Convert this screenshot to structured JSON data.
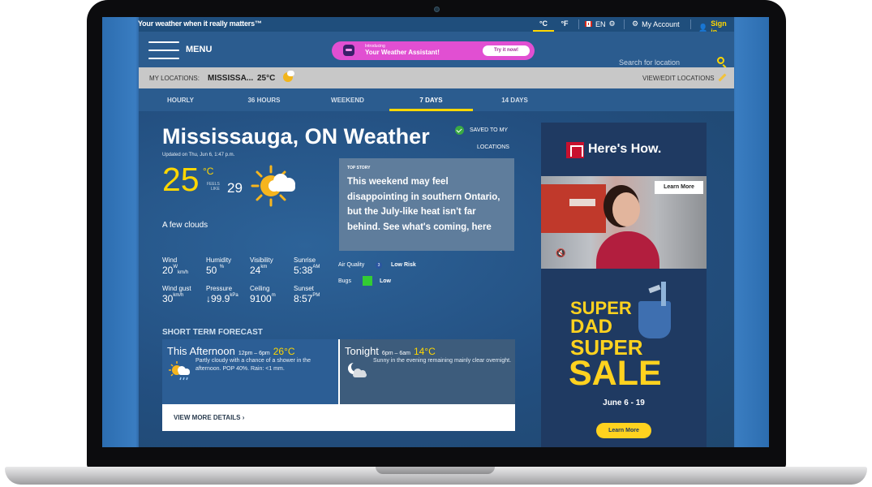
{
  "topbar": {
    "tagline": "Your weather when it really matters™",
    "unit_c": "°C",
    "unit_f": "°F",
    "lang": "EN",
    "my_account": "My Account",
    "sign_in": "Sign in"
  },
  "header": {
    "menu_label": "MENU",
    "assistant_intro": "Introducing",
    "assistant_title": "Your Weather Assistant!",
    "assistant_button": "Try it now!",
    "search_placeholder": "Search for location"
  },
  "locations_bar": {
    "label": "MY LOCATIONS:",
    "city": "MISSISSA...",
    "temp": "25°C",
    "edit_label": "VIEW/EDIT LOCATIONS"
  },
  "tabs": [
    {
      "label": "HOURLY",
      "active": false
    },
    {
      "label": "36 HOURS",
      "active": false
    },
    {
      "label": "WEEKEND",
      "active": false
    },
    {
      "label": "7 DAYS",
      "active": true
    },
    {
      "label": "14 DAYS",
      "active": false
    }
  ],
  "current": {
    "title": "Mississauga, ON Weather",
    "updated": "Updated on Thu, Jun 6, 1:47 p.m.",
    "saved_line1": "SAVED TO MY",
    "saved_line2": "LOCATIONS",
    "temp": "25",
    "temp_unit": "°C",
    "feels_like_label_1": "FEELS",
    "feels_like_label_2": "LIKE",
    "feels_like": "29",
    "condition": "A few clouds",
    "icon": "sun-cloud-icon"
  },
  "top_story": {
    "tag": "TOP STORY",
    "text": "This weekend may feel disappointing in southern Ontario, but the July-like heat isn't far behind. See what's coming, here"
  },
  "stats": {
    "wind": {
      "label": "Wind",
      "value": "20",
      "dir": "W",
      "unit": "km/h"
    },
    "humidity": {
      "label": "Humidity",
      "value": "50",
      "unit": "%"
    },
    "visibility": {
      "label": "Visibility",
      "value": "24",
      "unit": "km"
    },
    "sunrise": {
      "label": "Sunrise",
      "value": "5:38",
      "unit": "AM"
    },
    "wind_gust": {
      "label": "Wind gust",
      "value": "30",
      "unit": "km/h"
    },
    "pressure": {
      "label": "Pressure",
      "value": "↓99.9",
      "unit": "kPa"
    },
    "ceiling": {
      "label": "Ceiling",
      "value": "9100",
      "unit": "m"
    },
    "sunset": {
      "label": "Sunset",
      "value": "8:57",
      "unit": "PM"
    },
    "air_quality_label": "Air Quality",
    "air_quality_index": "3",
    "air_quality_value": "Low Risk",
    "bugs_label": "Bugs",
    "bugs_value": "Low"
  },
  "short_term": {
    "title": "SHORT TERM FORECAST",
    "periods": [
      {
        "name": "This Afternoon",
        "time": "12pm – 6pm",
        "temp": "26°C",
        "desc": "Partly cloudy with a chance of a shower in the afternoon. POP 40%. Rain: <1 mm.",
        "icon": "sun-cloud-rain-icon"
      },
      {
        "name": "Tonight",
        "time": "6pm – 6am",
        "temp": "14°C",
        "desc": "Sunny in the evening remaining mainly clear overnight.",
        "icon": "moon-cloud-icon"
      }
    ],
    "details_link": "VIEW MORE DETAILS ›"
  },
  "ad": {
    "brand": "Here's How.",
    "learn_more_top": "Learn More",
    "sale_1": "SUPER",
    "sale_2": "DAD",
    "sale_3": "SUPER",
    "sale_4": "SALE",
    "dates": "June 6 - 19",
    "learn_more_bottom": "Learn More",
    "mute_symbol": "🔇"
  },
  "colors": {
    "accent": "#ffd700",
    "site_blue": "#2b5c8f",
    "assistant_pink": "#e14fd2",
    "ad_navy": "#1f3a62"
  }
}
